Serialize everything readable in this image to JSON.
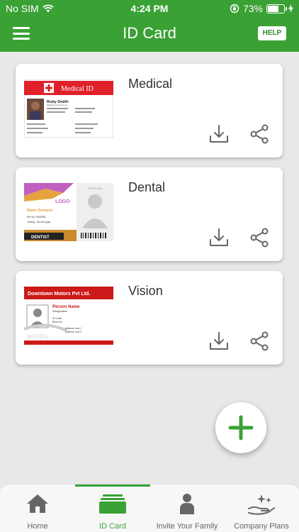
{
  "status_bar": {
    "carrier": "No SIM",
    "time": "4:24 PM",
    "battery": "73%",
    "battery_level": 0.73
  },
  "nav": {
    "title": "ID Card",
    "help_label": "HELP"
  },
  "cards": [
    {
      "title": "Medical",
      "thumb": {
        "header": "Medical ID",
        "name": "Ruby Smith",
        "line1": "Medical Insurance Co.",
        "line2": "Address Line",
        "footer_left": "Allergies",
        "footer_right": "Physician"
      }
    },
    {
      "title": "Dental",
      "thumb": {
        "logo": "LOGO",
        "name": "Name Surname",
        "line1": "Ser No: 0000000",
        "line2": "Joining : dd-mm-yyyy",
        "badge": "DENTIST",
        "photo_label": "PHOTO AND"
      }
    },
    {
      "title": "Vision",
      "thumb": {
        "company": "Downtown Motors Pvt Ltd.",
        "name": "Person Name",
        "designation": "Designation",
        "lines": [
          "ID Code",
          "Blood Gr.",
          "Address Line 1",
          "Address Line 2"
        ],
        "brand": "HONDA"
      }
    }
  ],
  "tabs": [
    {
      "label": "Home",
      "icon": "home-icon",
      "active": false
    },
    {
      "label": "ID Card",
      "icon": "id-card-icon",
      "active": true
    },
    {
      "label": "Invite Your Family",
      "icon": "person-icon",
      "active": false
    },
    {
      "label": "Company Plans",
      "icon": "hand-sparkle-icon",
      "active": false
    }
  ],
  "colors": {
    "brand": "#3aa135",
    "medical_red": "#e0202a",
    "vision_red": "#cc1a1a"
  }
}
